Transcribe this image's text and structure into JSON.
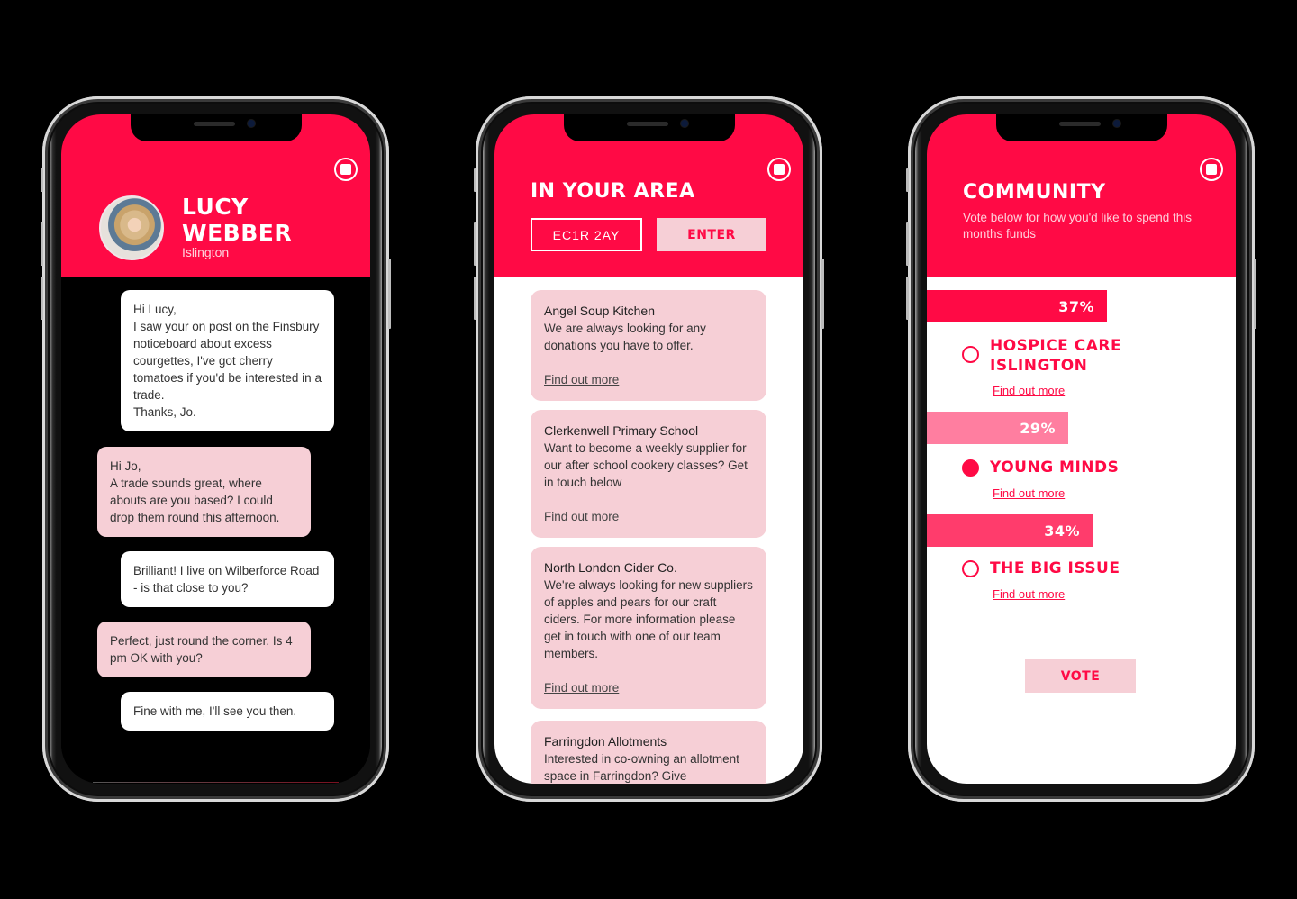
{
  "colors": {
    "brand_red": "#ff0a45",
    "light_pink": "#f6cfd6",
    "mid_pink": "#ff7ea0",
    "bar_pink": "#ff3c6c"
  },
  "icons": {
    "close": "stop-circle-icon"
  },
  "profile_screen": {
    "name_line1": "LUCY",
    "name_line2": "WEBBER",
    "location": "Islington",
    "messages": [
      {
        "from": "other",
        "text": "Hi Lucy,\nI saw your on post on the Finsbury noticeboard about excess courgettes, I've got cherry tomatoes if you'd be interested in a trade.\nThanks, Jo."
      },
      {
        "from": "me",
        "text": "Hi Jo,\nA trade sounds great, where abouts are you based? I could drop them round this afternoon."
      },
      {
        "from": "other",
        "text": "Brilliant! I live on Wilberforce Road - is that close to you?"
      },
      {
        "from": "me",
        "text": "Perfect, just round the corner. Is 4 pm OK with you?"
      },
      {
        "from": "other",
        "text": "Fine with me, I'll see you then."
      }
    ]
  },
  "area_screen": {
    "title": "IN YOUR AREA",
    "postcode_value": "EC1R 2AY",
    "enter_label": "ENTER",
    "listings": [
      {
        "title": "Angel Soup Kitchen",
        "description": "We are always looking for any donations you have to offer.",
        "link": "Find out more"
      },
      {
        "title": "Clerkenwell Primary School",
        "description": "Want to become a weekly supplier for our after school cookery classes? Get in touch below",
        "link": "Find out more"
      },
      {
        "title": "North London Cider Co.",
        "description": "We're always looking for new suppliers of apples and pears for our craft ciders. For more information please get in touch with one of our team members.",
        "link": "Find out more"
      },
      {
        "title": "Farringdon Allotments",
        "description": "Interested in co-owning an allotment space in Farringdon? Give",
        "link": ""
      }
    ]
  },
  "community_screen": {
    "title": "COMMUNITY",
    "subtitle": "Vote below for how you'd like to spend this months funds",
    "options": [
      {
        "label": "HOSPICE CARE ISLINGTON",
        "percent_label": "37%",
        "percent": 37,
        "selected": false,
        "link": "Find out more"
      },
      {
        "label": "YOUNG MINDS",
        "percent_label": "29%",
        "percent": 29,
        "selected": true,
        "link": "Find out more"
      },
      {
        "label": "THE BIG ISSUE",
        "percent_label": "34%",
        "percent": 34,
        "selected": false,
        "link": "Find out more"
      }
    ],
    "vote_label": "VOTE"
  }
}
